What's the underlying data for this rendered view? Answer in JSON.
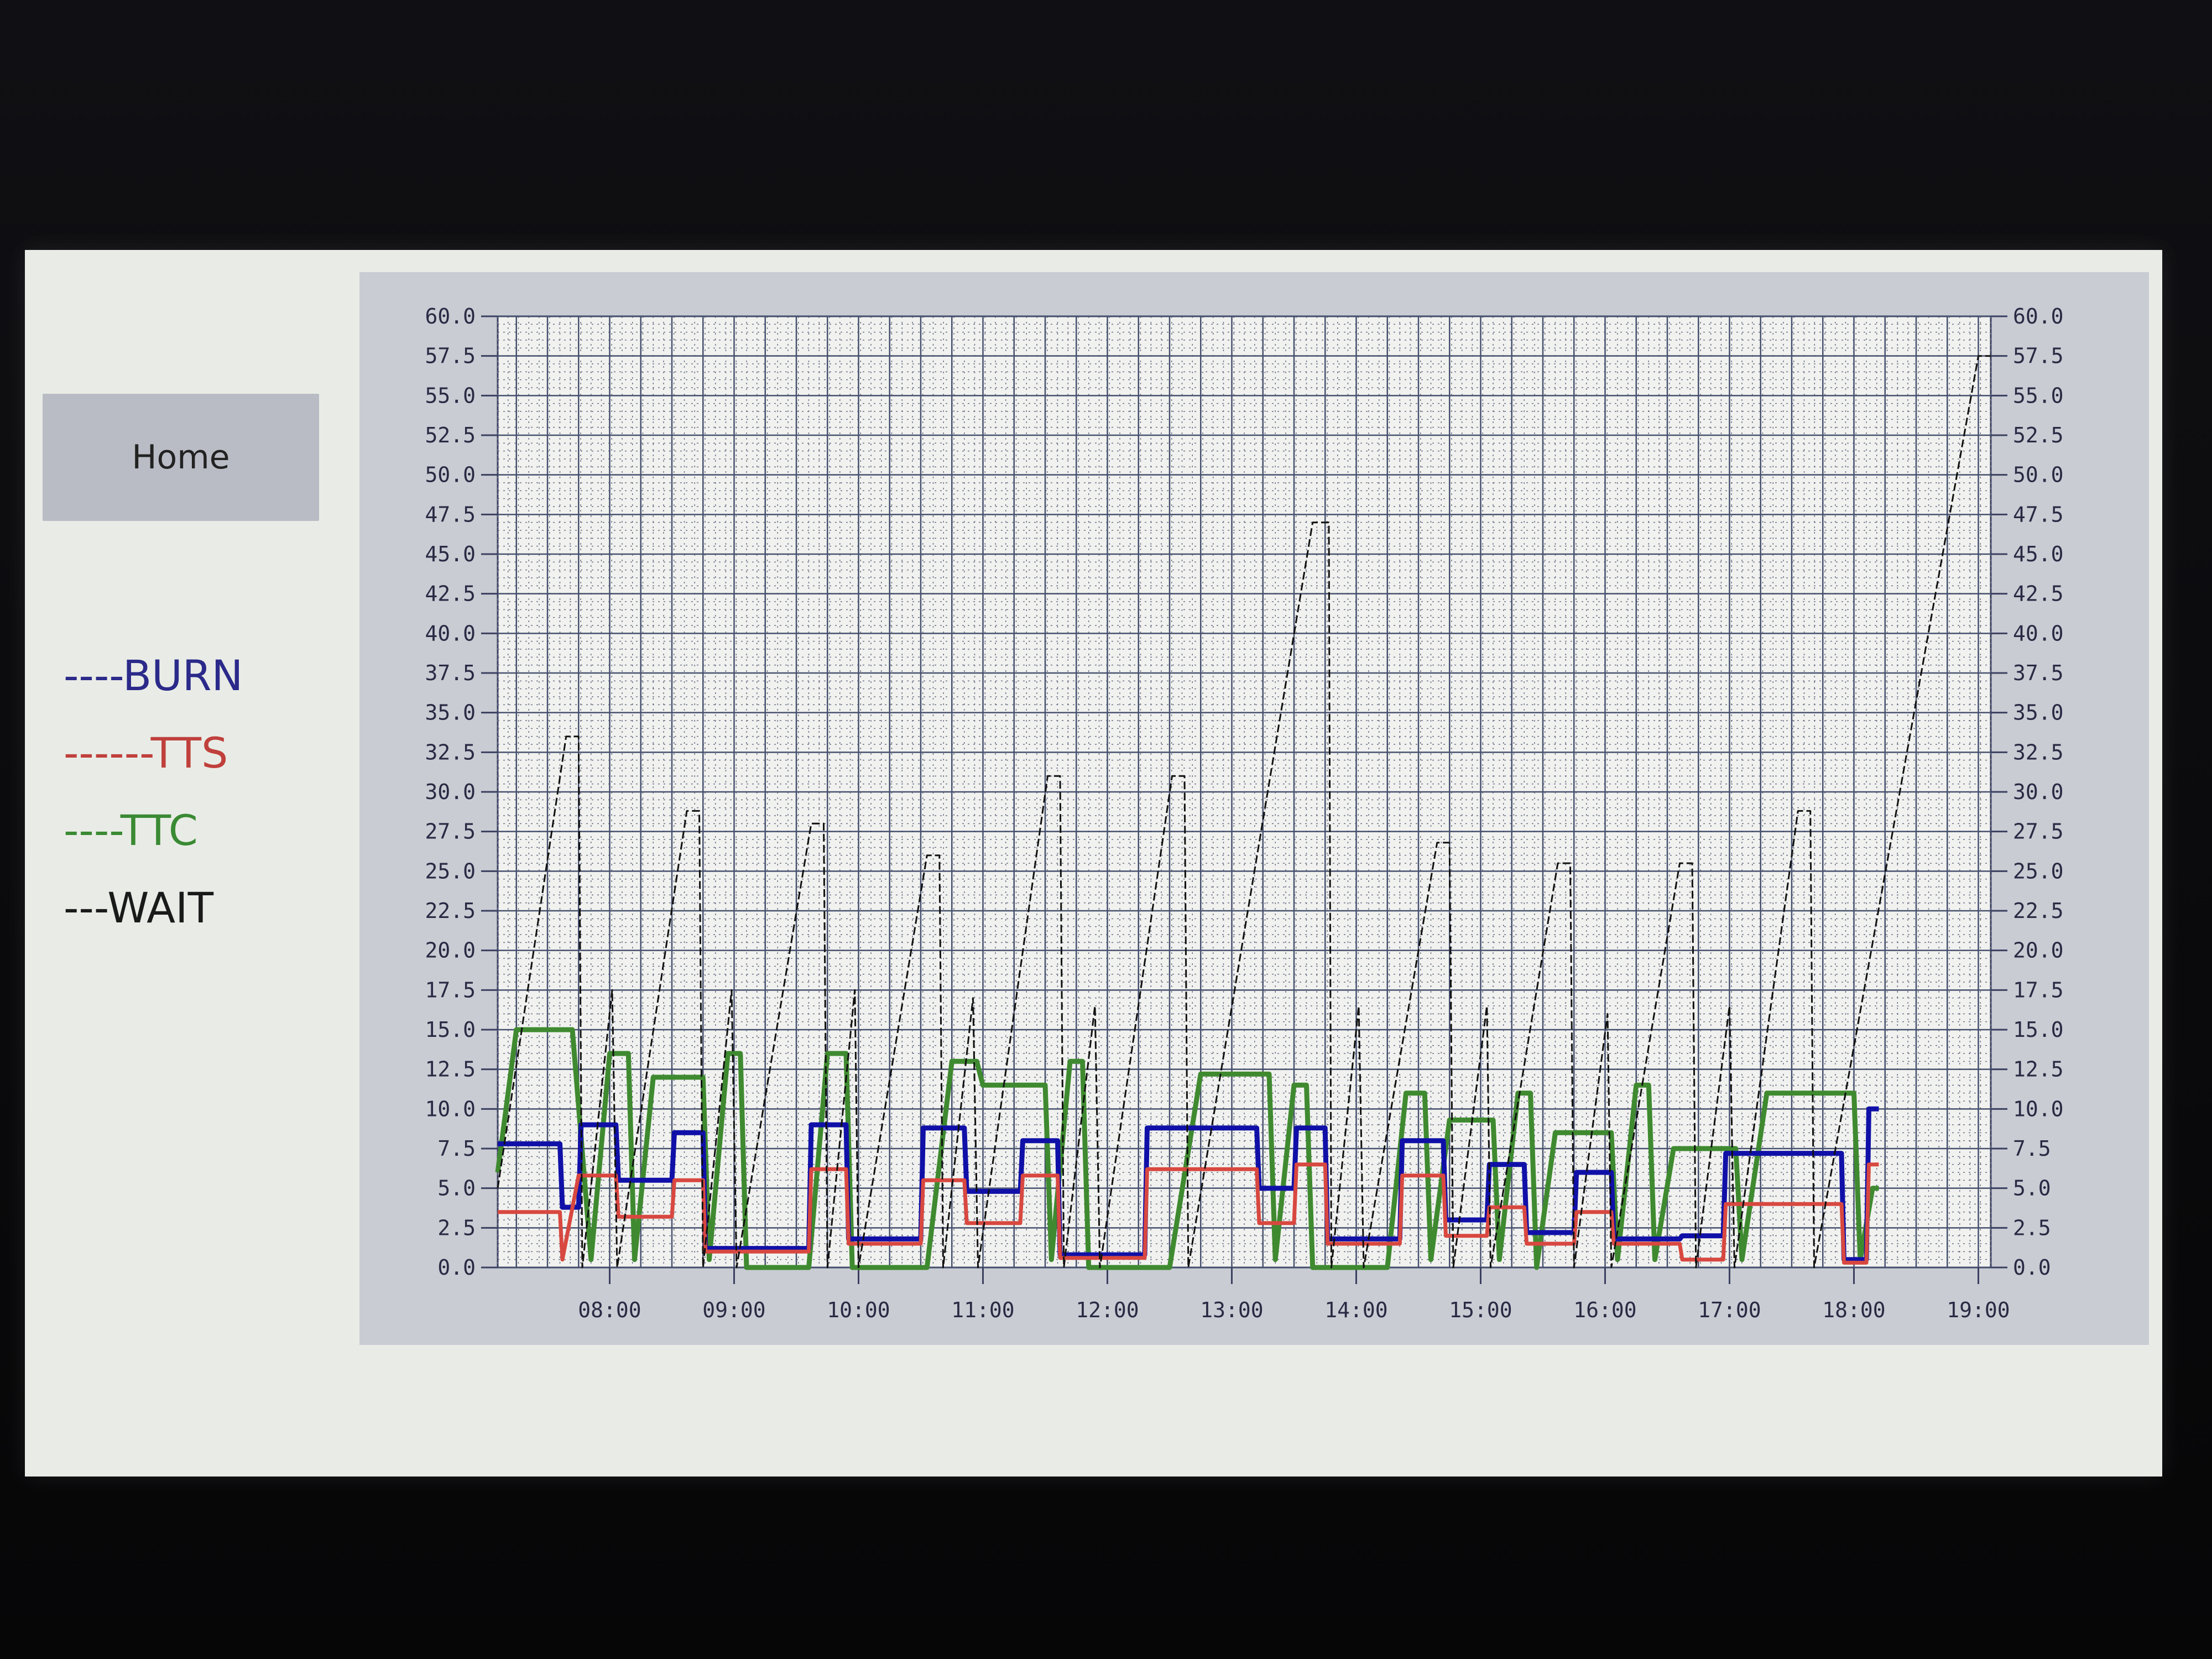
{
  "home": {
    "label": "Home"
  },
  "legend": [
    {
      "label": "----BURN",
      "color": "#2b2a8a"
    },
    {
      "label": "------TTS",
      "color": "#c0403c"
    },
    {
      "label": "----TTC",
      "color": "#3a8a34"
    },
    {
      "label": "---WAIT",
      "color": "#1a1a1a"
    }
  ],
  "chart_data": {
    "type": "line",
    "x_ticks": [
      "08:00",
      "09:00",
      "10:00",
      "11:00",
      "12:00",
      "13:00",
      "14:00",
      "15:00",
      "16:00",
      "17:00",
      "18:00",
      "19:00"
    ],
    "y_ticks": [
      "60.0",
      "57.5",
      "55.0",
      "52.5",
      "50.0",
      "47.5",
      "45.0",
      "42.5",
      "40.0",
      "37.5",
      "35.0",
      "32.5",
      "30.0",
      "27.5",
      "25.0",
      "22.5",
      "20.0",
      "17.5",
      "15.0",
      "12.5",
      "10.0",
      "7.5",
      "5.0",
      "2.5",
      "0.0"
    ],
    "xlim": [
      7.1,
      19.1
    ],
    "ylim": [
      0,
      60
    ],
    "grid": true,
    "colors": {
      "BURN": "#1010a8",
      "TTS": "#d84840",
      "TTC": "#3f8a30",
      "WAIT": "#111111"
    },
    "series": [
      {
        "key": "BURN",
        "points": [
          [
            7.1,
            7.8
          ],
          [
            7.6,
            7.8
          ],
          [
            7.62,
            3.8
          ],
          [
            7.75,
            3.8
          ],
          [
            7.77,
            9.0
          ],
          [
            8.05,
            9.0
          ],
          [
            8.07,
            5.5
          ],
          [
            8.5,
            5.5
          ],
          [
            8.52,
            8.5
          ],
          [
            8.75,
            8.5
          ],
          [
            8.77,
            1.2
          ],
          [
            9.6,
            1.2
          ],
          [
            9.62,
            9.0
          ],
          [
            9.9,
            9.0
          ],
          [
            9.92,
            1.8
          ],
          [
            10.5,
            1.8
          ],
          [
            10.52,
            8.8
          ],
          [
            10.85,
            8.8
          ],
          [
            10.87,
            4.8
          ],
          [
            11.3,
            4.8
          ],
          [
            11.32,
            8.0
          ],
          [
            11.6,
            8.0
          ],
          [
            11.62,
            0.8
          ],
          [
            12.3,
            0.8
          ],
          [
            12.32,
            8.8
          ],
          [
            13.2,
            8.8
          ],
          [
            13.22,
            5.0
          ],
          [
            13.5,
            5.0
          ],
          [
            13.52,
            8.8
          ],
          [
            13.75,
            8.8
          ],
          [
            13.77,
            1.8
          ],
          [
            14.35,
            1.8
          ],
          [
            14.37,
            8.0
          ],
          [
            14.7,
            8.0
          ],
          [
            14.72,
            3.0
          ],
          [
            15.05,
            3.0
          ],
          [
            15.07,
            6.5
          ],
          [
            15.35,
            6.5
          ],
          [
            15.37,
            2.2
          ],
          [
            15.75,
            2.2
          ],
          [
            15.77,
            6.0
          ],
          [
            16.05,
            6.0
          ],
          [
            16.07,
            1.8
          ],
          [
            16.6,
            1.8
          ],
          [
            16.62,
            2.0
          ],
          [
            16.95,
            2.0
          ],
          [
            16.97,
            7.2
          ],
          [
            17.9,
            7.2
          ],
          [
            17.92,
            0.5
          ],
          [
            18.1,
            0.5
          ],
          [
            18.12,
            10.0
          ],
          [
            18.2,
            10.0
          ]
        ]
      },
      {
        "key": "TTS",
        "points": [
          [
            7.1,
            3.5
          ],
          [
            7.6,
            3.5
          ],
          [
            7.62,
            0.5
          ],
          [
            7.75,
            5.8
          ],
          [
            8.05,
            5.8
          ],
          [
            8.07,
            3.2
          ],
          [
            8.5,
            3.2
          ],
          [
            8.52,
            5.5
          ],
          [
            8.75,
            5.5
          ],
          [
            8.77,
            1.0
          ],
          [
            9.6,
            1.0
          ],
          [
            9.62,
            6.2
          ],
          [
            9.9,
            6.2
          ],
          [
            9.92,
            1.5
          ],
          [
            10.5,
            1.5
          ],
          [
            10.52,
            5.5
          ],
          [
            10.85,
            5.5
          ],
          [
            10.87,
            2.8
          ],
          [
            11.3,
            2.8
          ],
          [
            11.32,
            5.8
          ],
          [
            11.6,
            5.8
          ],
          [
            11.62,
            0.6
          ],
          [
            12.3,
            0.6
          ],
          [
            12.32,
            6.2
          ],
          [
            13.2,
            6.2
          ],
          [
            13.22,
            2.8
          ],
          [
            13.5,
            2.8
          ],
          [
            13.52,
            6.5
          ],
          [
            13.75,
            6.5
          ],
          [
            13.77,
            1.5
          ],
          [
            14.35,
            1.5
          ],
          [
            14.37,
            5.8
          ],
          [
            14.7,
            5.8
          ],
          [
            14.72,
            2.0
          ],
          [
            15.05,
            2.0
          ],
          [
            15.07,
            3.8
          ],
          [
            15.35,
            3.8
          ],
          [
            15.37,
            1.5
          ],
          [
            15.75,
            1.5
          ],
          [
            15.77,
            3.5
          ],
          [
            16.05,
            3.5
          ],
          [
            16.07,
            1.5
          ],
          [
            16.6,
            1.5
          ],
          [
            16.62,
            0.5
          ],
          [
            16.95,
            0.5
          ],
          [
            16.97,
            4.0
          ],
          [
            17.9,
            4.0
          ],
          [
            17.92,
            0.3
          ],
          [
            18.1,
            0.3
          ],
          [
            18.12,
            6.5
          ],
          [
            18.2,
            6.5
          ]
        ]
      },
      {
        "key": "TTC",
        "points": [
          [
            7.1,
            6.0
          ],
          [
            7.25,
            15.0
          ],
          [
            7.7,
            15.0
          ],
          [
            7.85,
            0.5
          ],
          [
            8.0,
            13.5
          ],
          [
            8.15,
            13.5
          ],
          [
            8.2,
            0.5
          ],
          [
            8.35,
            12.0
          ],
          [
            8.75,
            12.0
          ],
          [
            8.8,
            0.5
          ],
          [
            8.95,
            13.5
          ],
          [
            9.05,
            13.5
          ],
          [
            9.1,
            0.0
          ],
          [
            9.6,
            0.0
          ],
          [
            9.75,
            13.5
          ],
          [
            9.9,
            13.5
          ],
          [
            9.95,
            0.0
          ],
          [
            10.55,
            0.0
          ],
          [
            10.75,
            13.0
          ],
          [
            10.95,
            13.0
          ],
          [
            11.0,
            11.5
          ],
          [
            11.5,
            11.5
          ],
          [
            11.55,
            0.5
          ],
          [
            11.7,
            13.0
          ],
          [
            11.8,
            13.0
          ],
          [
            11.85,
            0.0
          ],
          [
            12.5,
            0.0
          ],
          [
            12.75,
            12.2
          ],
          [
            13.3,
            12.2
          ],
          [
            13.35,
            0.5
          ],
          [
            13.5,
            11.5
          ],
          [
            13.6,
            11.5
          ],
          [
            13.65,
            0.0
          ],
          [
            14.25,
            0.0
          ],
          [
            14.4,
            11.0
          ],
          [
            14.55,
            11.0
          ],
          [
            14.6,
            0.5
          ],
          [
            14.75,
            9.3
          ],
          [
            15.1,
            9.3
          ],
          [
            15.15,
            0.5
          ],
          [
            15.3,
            11.0
          ],
          [
            15.4,
            11.0
          ],
          [
            15.45,
            0.0
          ],
          [
            15.6,
            8.5
          ],
          [
            16.05,
            8.5
          ],
          [
            16.1,
            0.5
          ],
          [
            16.25,
            11.5
          ],
          [
            16.35,
            11.5
          ],
          [
            16.4,
            0.5
          ],
          [
            16.55,
            7.5
          ],
          [
            17.05,
            7.5
          ],
          [
            17.1,
            0.5
          ],
          [
            17.3,
            11.0
          ],
          [
            18.0,
            11.0
          ],
          [
            18.05,
            0.5
          ],
          [
            18.15,
            5.0
          ],
          [
            18.2,
            5.0
          ]
        ]
      },
      {
        "key": "WAIT",
        "points": [
          [
            7.1,
            5.0
          ],
          [
            7.65,
            33.5
          ],
          [
            7.75,
            33.5
          ],
          [
            7.78,
            0.0
          ],
          [
            8.02,
            17.5
          ],
          [
            8.06,
            0.0
          ],
          [
            8.62,
            28.8
          ],
          [
            8.72,
            28.8
          ],
          [
            8.75,
            0.0
          ],
          [
            8.98,
            17.5
          ],
          [
            9.02,
            0.0
          ],
          [
            9.62,
            28.0
          ],
          [
            9.72,
            28.0
          ],
          [
            9.75,
            0.0
          ],
          [
            9.97,
            17.5
          ],
          [
            10.0,
            0.0
          ],
          [
            10.55,
            26.0
          ],
          [
            10.65,
            26.0
          ],
          [
            10.68,
            0.0
          ],
          [
            10.92,
            17.0
          ],
          [
            10.96,
            0.0
          ],
          [
            11.52,
            31.0
          ],
          [
            11.62,
            31.0
          ],
          [
            11.65,
            0.0
          ],
          [
            11.9,
            16.5
          ],
          [
            11.94,
            0.0
          ],
          [
            12.52,
            31.0
          ],
          [
            12.62,
            31.0
          ],
          [
            12.65,
            0.0
          ],
          [
            13.65,
            47.0
          ],
          [
            13.78,
            47.0
          ],
          [
            13.8,
            0.0
          ],
          [
            14.02,
            16.5
          ],
          [
            14.06,
            0.0
          ],
          [
            14.65,
            26.8
          ],
          [
            14.75,
            26.8
          ],
          [
            14.78,
            0.0
          ],
          [
            15.05,
            16.5
          ],
          [
            15.08,
            0.0
          ],
          [
            15.62,
            25.5
          ],
          [
            15.72,
            25.5
          ],
          [
            15.75,
            0.0
          ],
          [
            16.02,
            16.0
          ],
          [
            16.05,
            0.0
          ],
          [
            16.6,
            25.5
          ],
          [
            16.7,
            25.5
          ],
          [
            16.73,
            0.0
          ],
          [
            17.0,
            16.5
          ],
          [
            17.04,
            0.0
          ],
          [
            17.55,
            28.8
          ],
          [
            17.65,
            28.8
          ],
          [
            17.68,
            0.0
          ],
          [
            19.0,
            57.5
          ],
          [
            19.1,
            57.5
          ]
        ]
      }
    ]
  }
}
